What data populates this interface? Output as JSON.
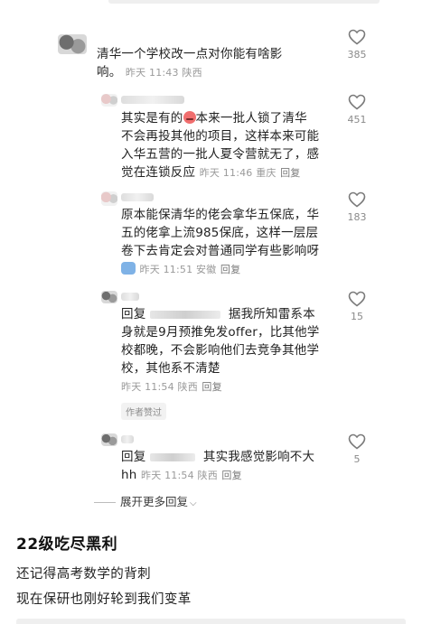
{
  "comments": [
    {
      "text_line1": "清华一个学校改一点对你能有啥影",
      "text_line2": "响。",
      "time": "昨天 11:43",
      "location": "陕西",
      "likes": "385"
    },
    {
      "text_line1": "其实是有的",
      "text_line1b": "本来一批人锁了清华",
      "text_line2": "不会再投其他的项目，这样本来可能",
      "text_line3": "入华五营的一批人夏令营就无了，感",
      "text_line4": "觉在连锁反应",
      "time": "昨天 11:46",
      "location": "重庆",
      "reply": "回复",
      "likes": "451"
    },
    {
      "text_line1": "原本能保清华的佬会拿华五保底，华",
      "text_line2": "五的佬拿上流985保底，这样一层层",
      "text_line3": "卷下去肯定会对普通同学有些影响呀",
      "time": "昨天 11:51",
      "location": "安徽",
      "reply": "回复",
      "likes": "183"
    },
    {
      "prefix": "回复",
      "text_line1": "据我所知雷系本",
      "text_line2": "身就是9月预推免发offer，比其他学",
      "text_line3": "校都晚，不会影响他们去竞争其他学",
      "text_line4": "校，其他系不清楚",
      "time": "昨天 11:54",
      "location": "陕西",
      "reply": "回复",
      "tag": "作者赞过",
      "likes": "15"
    },
    {
      "prefix": "回复",
      "text_line1": "其实我感觉影响不大",
      "text_line2": "hh",
      "time": "昨天 11:54",
      "location": "陕西",
      "reply": "回复",
      "likes": "5"
    }
  ],
  "expand_more": "展开更多回复",
  "post": {
    "title": "22级吃尽黑利",
    "line1": "还记得高考数学的背刺",
    "line2": "现在保研也刚好轮到我们变革"
  }
}
